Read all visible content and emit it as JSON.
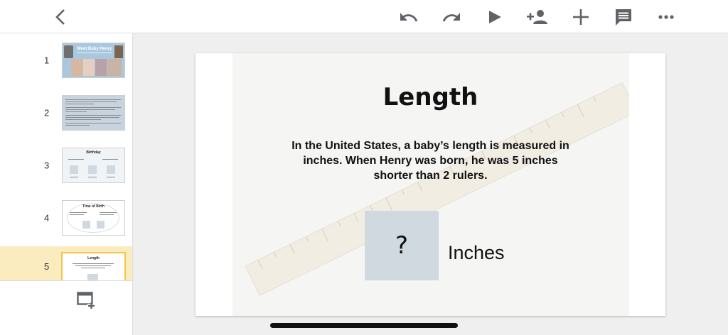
{
  "toolbar": {
    "back_icon": "chevron-left-icon",
    "undo_icon": "undo-icon",
    "redo_icon": "redo-icon",
    "present_icon": "play-icon",
    "share_icon": "add-person-icon",
    "insert_icon": "plus-icon",
    "comment_icon": "comment-icon",
    "more_icon": "more-horizontal-icon"
  },
  "sidebar": {
    "slides": [
      {
        "number": "1",
        "title": "Meet Baby Henry"
      },
      {
        "number": "2",
        "title": ""
      },
      {
        "number": "3",
        "title": "Birthday"
      },
      {
        "number": "4",
        "title": "Time of Birth"
      },
      {
        "number": "5",
        "title": "Length"
      }
    ],
    "selected_index": 4,
    "add_slide_icon": "new-slide-icon"
  },
  "slide": {
    "title": "Length",
    "body": "In the United States, a baby’s length is measured in inches. When Henry was born, he was 5 inches shorter than 2 rulers.",
    "answer_placeholder": "?",
    "unit": "Inches"
  },
  "colors": {
    "selected_thumb": "#fbecc0",
    "answer_box": "#cfd9df",
    "toolbar_icon": "#5f6368"
  }
}
